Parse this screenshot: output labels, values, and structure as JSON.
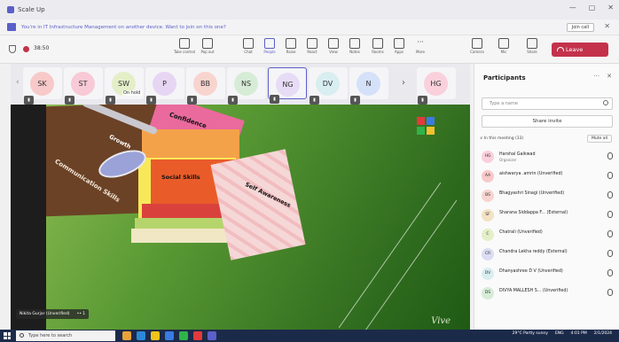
{
  "window": {
    "title": "Scale Up",
    "controls": [
      "—",
      "▢",
      "✕"
    ]
  },
  "notice": {
    "text": "You're in IT Infrastructure Management on another device. Want to join on this one?",
    "join_label": "Join call",
    "close_label": "✕"
  },
  "toolbar": {
    "timer": "38:50",
    "buttons": [
      {
        "label": "Take control"
      },
      {
        "label": "Pop out"
      },
      {
        "label": "Chat"
      },
      {
        "label": "People"
      },
      {
        "label": "Raise"
      },
      {
        "label": "React"
      },
      {
        "label": "View"
      },
      {
        "label": "Notes"
      },
      {
        "label": "Rooms"
      },
      {
        "label": "Apps"
      },
      {
        "label": "More"
      },
      {
        "label": "Camera"
      },
      {
        "label": "Mic"
      },
      {
        "label": "Share"
      }
    ],
    "leave_label": "Leave"
  },
  "strip": {
    "tiles": [
      {
        "initials": "SK",
        "color": "#f8c9c9"
      },
      {
        "initials": "ST",
        "color": "#f8c9d6"
      },
      {
        "initials": "SW",
        "color": "#e4efc8",
        "status": "On hold"
      },
      {
        "initials": "P",
        "color": "#e7d6f3"
      },
      {
        "initials": "BB",
        "color": "#f8d4cf"
      },
      {
        "initials": "NS",
        "color": "#d6ecd6"
      },
      {
        "initials": "NG",
        "color": "#e7dcf6"
      },
      {
        "initials": "DV",
        "color": "#d9eef0"
      },
      {
        "initials": "N",
        "color": "#d5e1f8"
      },
      {
        "initials": "HG",
        "color": "#f9d0dc"
      }
    ],
    "next": "›",
    "prev": "‹"
  },
  "slide": {
    "labels": {
      "communication": "Communication Skills",
      "growth": "Growth",
      "confidence": "Confidence",
      "social": "Social Skills",
      "self": "Self Awareness"
    },
    "signature": "Vive"
  },
  "presenter": {
    "name": "Nikita Gurjar (Unverified)",
    "extra": "•• 1"
  },
  "panel": {
    "title": "Participants",
    "more": "···",
    "close": "✕",
    "search_placeholder": "Type a name",
    "share_invite": "Share invite",
    "section_label": "∨ In this meeting (33)",
    "mute_all": "Mute all",
    "participants": [
      {
        "initials": "HG",
        "name": "Harshal Gaikwad",
        "role": "Organizer",
        "color": "#f9d0dc"
      },
      {
        "initials": "AA",
        "name": "aishwarya .amrin (Unverified)",
        "role": "",
        "color": "#f8c9c9"
      },
      {
        "initials": "BS",
        "name": "Bhagyashri Sinagi (Unverified)",
        "role": "",
        "color": "#f8d4cf"
      },
      {
        "initials": "SF",
        "name": "Sharana Siddappa F... (External)",
        "role": "",
        "color": "#f3e2c4"
      },
      {
        "initials": "C",
        "name": "Chatrali (Unverified)",
        "role": "",
        "color": "#e4efc8"
      },
      {
        "initials": "CR",
        "name": "Chandra Lekha reddy (External)",
        "role": "",
        "color": "#dcdcf4"
      },
      {
        "initials": "DV",
        "name": "Dhanyashree D V (Unverified)",
        "role": "",
        "color": "#d9eef0"
      },
      {
        "initials": "DS",
        "name": "DIVYA MALLESH S... (Unverified)",
        "role": "",
        "color": "#d6ecd6"
      }
    ]
  },
  "taskbar": {
    "search_placeholder": "Type here to search",
    "weather": "29°C Partly sunny",
    "lang": "ENG",
    "time": "4:01 PM",
    "date": "2/1/2024"
  },
  "colors": {
    "accent": "#5b5fc7",
    "leave": "#c4314b",
    "taskbar": "#1c2a4a"
  }
}
